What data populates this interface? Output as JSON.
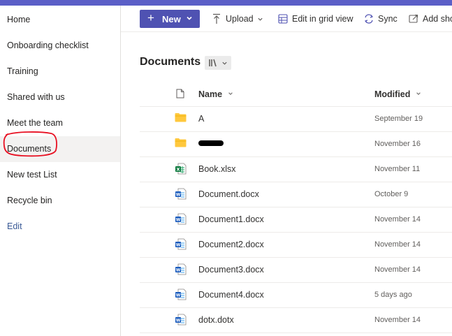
{
  "colors": {
    "accent": "#4f52b2",
    "top_stripe": "#5b5fc7",
    "folder": "#ffc83d",
    "excel": "#107c41",
    "word": "#185abd",
    "annotation": "#e81123"
  },
  "sidebar": {
    "items": [
      {
        "label": "Home"
      },
      {
        "label": "Onboarding checklist"
      },
      {
        "label": "Training"
      },
      {
        "label": "Shared with us"
      },
      {
        "label": "Meet the team"
      },
      {
        "label": "Documents",
        "selected": true
      },
      {
        "label": "New test List"
      },
      {
        "label": "Recycle bin"
      }
    ],
    "edit_label": "Edit"
  },
  "toolbar": {
    "new_label": "New",
    "upload_label": "Upload",
    "grid_label": "Edit in grid view",
    "sync_label": "Sync",
    "shortcut_label": "Add sho"
  },
  "library": {
    "title": "Documents"
  },
  "table": {
    "columns": {
      "name": "Name",
      "modified": "Modified"
    },
    "rows": [
      {
        "type": "folder",
        "name": "A",
        "modified": "September 19"
      },
      {
        "type": "folder",
        "name": "",
        "modified": "November 16",
        "redacted": true
      },
      {
        "type": "excel",
        "name": "Book.xlsx",
        "modified": "November 11"
      },
      {
        "type": "word",
        "name": "Document.docx",
        "modified": "October 9"
      },
      {
        "type": "word",
        "name": "Document1.docx",
        "modified": "November 14"
      },
      {
        "type": "word",
        "name": "Document2.docx",
        "modified": "November 14"
      },
      {
        "type": "word",
        "name": "Document3.docx",
        "modified": "November 14"
      },
      {
        "type": "word",
        "name": "Document4.docx",
        "modified": "5 days ago"
      },
      {
        "type": "word",
        "name": "dotx.dotx",
        "modified": "November 14"
      }
    ]
  }
}
